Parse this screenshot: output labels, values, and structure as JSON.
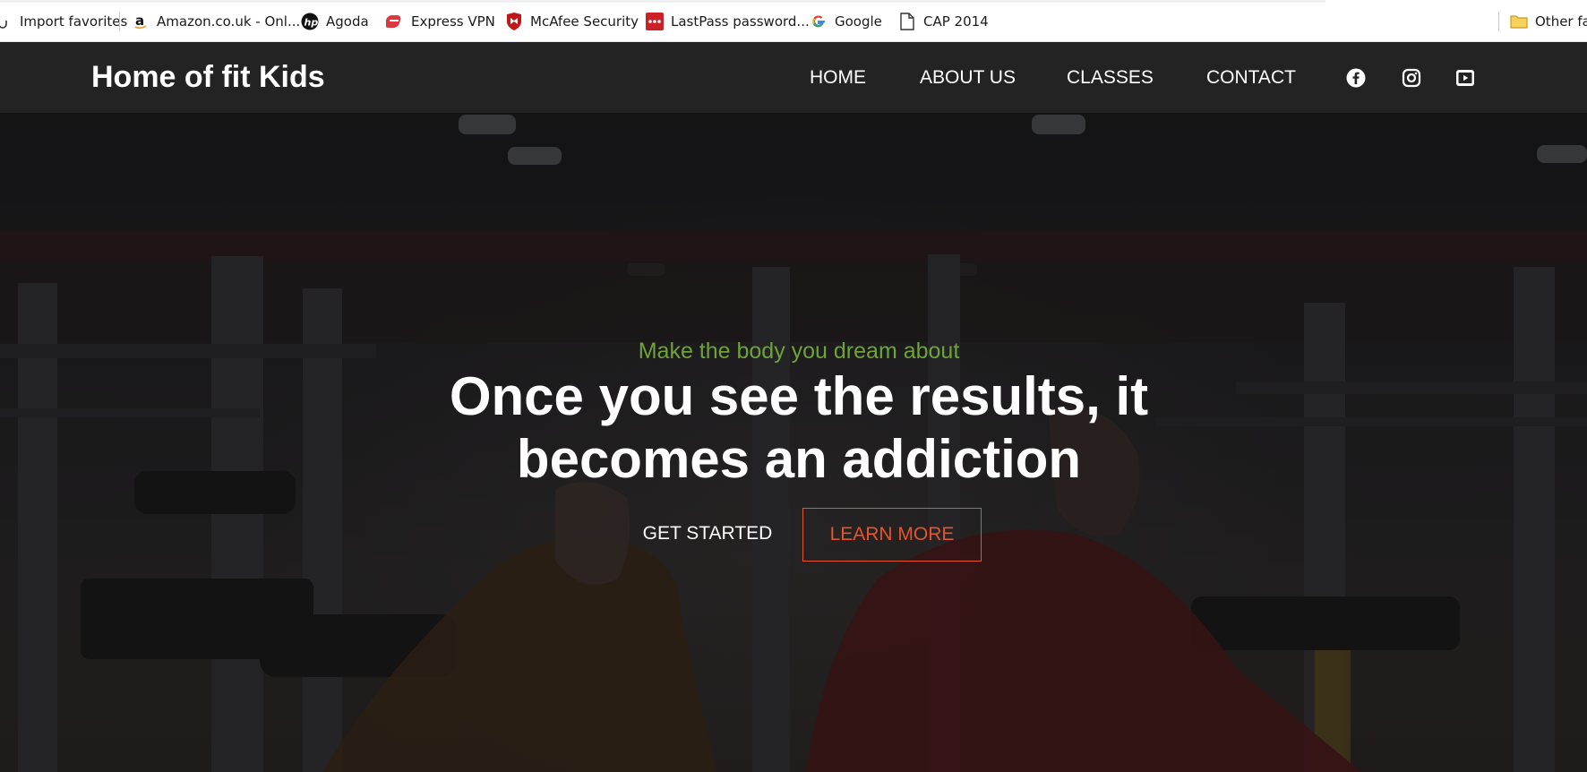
{
  "bookmarks": {
    "items": [
      {
        "label": "Import favorites",
        "icon": "import-icon"
      },
      {
        "label": "Amazon.co.uk - Onl...",
        "icon": "amazon-icon"
      },
      {
        "label": "Agoda",
        "icon": "hp-icon"
      },
      {
        "label": "Express VPN",
        "icon": "expressvpn-icon"
      },
      {
        "label": "McAfee Security",
        "icon": "mcafee-icon"
      },
      {
        "label": "LastPass password...",
        "icon": "lastpass-icon"
      },
      {
        "label": "Google",
        "icon": "google-icon"
      },
      {
        "label": "CAP 2014",
        "icon": "page-icon"
      }
    ],
    "other": {
      "label": "Other fav",
      "icon": "folder-icon"
    }
  },
  "site": {
    "brand": "Home of fit Kids",
    "nav": [
      "HOME",
      "ABOUT US",
      "CLASSES",
      "CONTACT"
    ],
    "social": [
      "facebook-icon",
      "instagram-icon",
      "youtube-icon"
    ]
  },
  "hero": {
    "tagline": "Make the body you dream about",
    "headline_line1": "Once you see the results, it",
    "headline_line2": "becomes an addiction",
    "cta_primary": "GET STARTED",
    "cta_secondary": "LEARN MORE"
  },
  "colors": {
    "nav_bg": "#232323",
    "tagline_green": "#6fa33a",
    "accent_orange": "#e8542a"
  }
}
